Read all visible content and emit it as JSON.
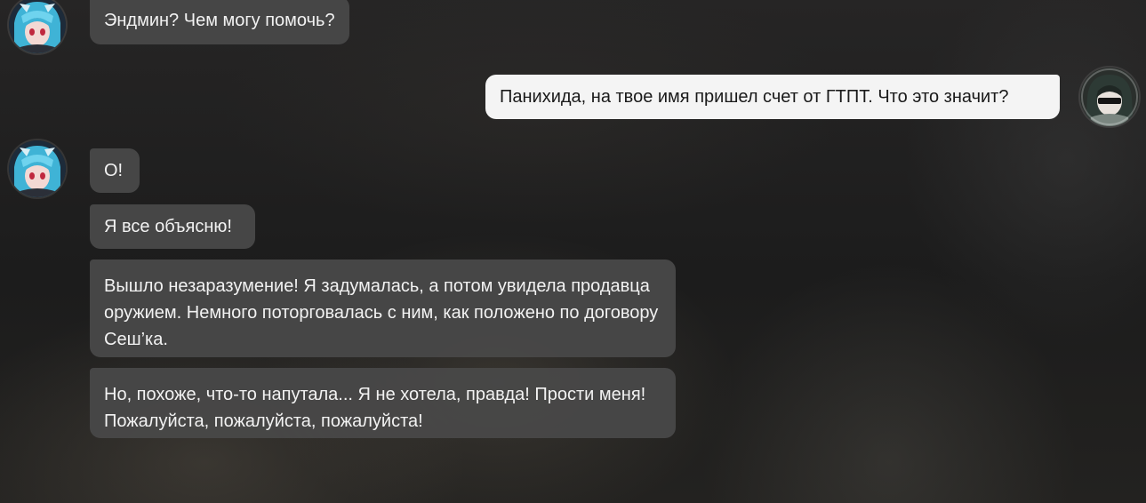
{
  "conversation": {
    "messages": [
      {
        "from": "bot",
        "text": "Эндмин? Чем могу помочь?"
      },
      {
        "from": "user",
        "text": "Панихида, на твое имя пришел счет от ГТПТ. Что это значит?"
      },
      {
        "from": "bot",
        "text": "О!"
      },
      {
        "from": "bot",
        "text": "Я все объясню!"
      },
      {
        "from": "bot",
        "text": "Вышло незаразумение! Я задумалась, а потом увидела продавца оружием. Немного поторговалась с ним, как положено по договору Сеш’ка."
      },
      {
        "from": "bot",
        "text": "Но, похоже, что-то напутала... Я не хотела, правда! Прости меня! Пожалуйста, пожалуйста, пожалуйста!"
      }
    ]
  },
  "avatars": {
    "bot_icon": "character-avatar-icon",
    "user_icon": "player-avatar-icon"
  },
  "colors": {
    "incoming_bubble": "#484848",
    "outgoing_bubble": "#f4f4f4",
    "incoming_text": "#f2f2f2",
    "outgoing_text": "#1a1a1a"
  }
}
